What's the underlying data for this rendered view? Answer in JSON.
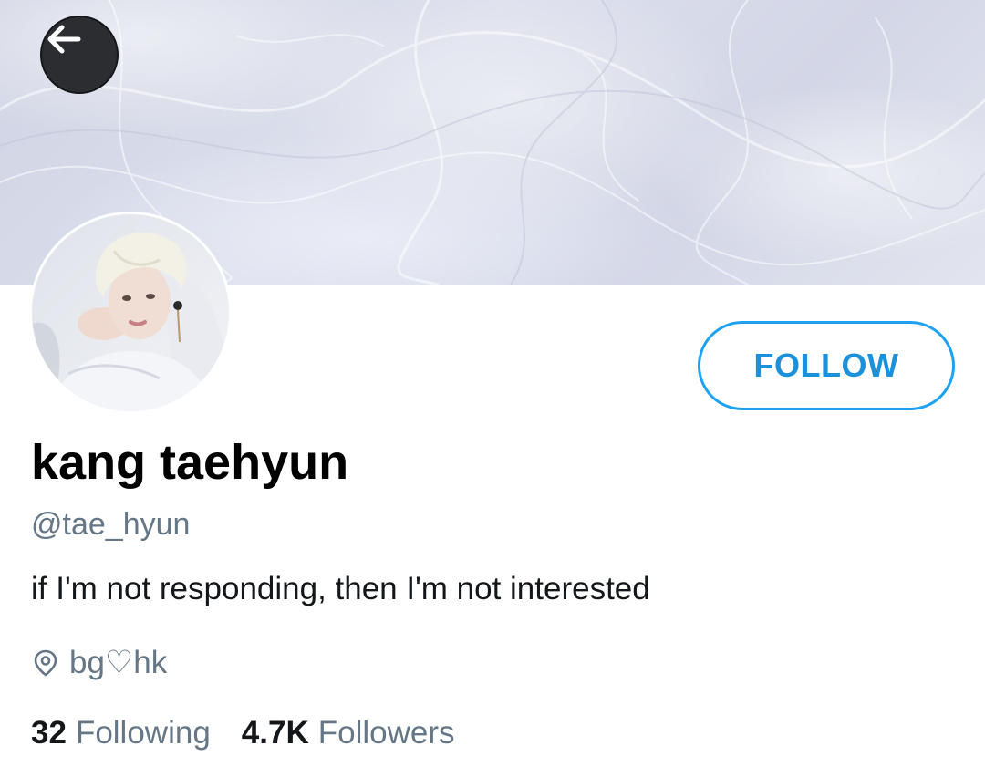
{
  "header": {
    "back_icon": "arrow-left-icon",
    "banner_color": "#d6d9e7"
  },
  "profile": {
    "display_name": "kang taehyun",
    "handle": "@tae_hyun",
    "bio": "if I'm not responding, then I'm not interested",
    "location_icon": "location-pin-icon",
    "location": "bg♡hk"
  },
  "actions": {
    "follow_label": "FOLLOW",
    "accent_color": "#1da1f2"
  },
  "stats": {
    "following_count": "32",
    "following_label": "Following",
    "followers_count": "4.7K",
    "followers_label": "Followers"
  }
}
